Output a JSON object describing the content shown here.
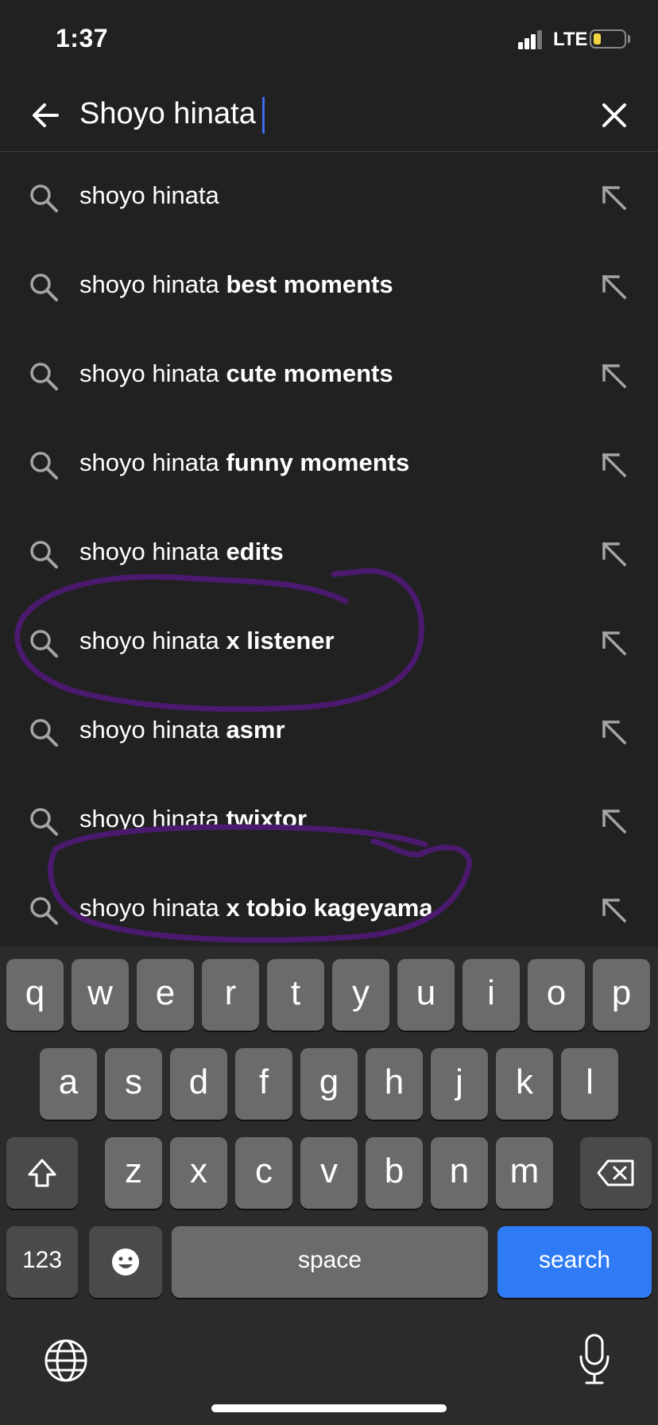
{
  "status": {
    "time": "1:37",
    "network": "LTE",
    "battery_level": 0.25,
    "signal_bars": 3
  },
  "search": {
    "query": "Shoyo hinata"
  },
  "suggestions": [
    {
      "prefix": "shoyo hinata",
      "suffix": ""
    },
    {
      "prefix": "shoyo hinata",
      "suffix": "best moments"
    },
    {
      "prefix": "shoyo hinata",
      "suffix": "cute moments"
    },
    {
      "prefix": "shoyo hinata",
      "suffix": "funny moments"
    },
    {
      "prefix": "shoyo hinata",
      "suffix": "edits"
    },
    {
      "prefix": "shoyo hinata",
      "suffix": "x listener"
    },
    {
      "prefix": "shoyo hinata",
      "suffix": "asmr"
    },
    {
      "prefix": "shoyo hinata",
      "suffix": "twixtor"
    },
    {
      "prefix": "shoyo hinata",
      "suffix": "x tobio kageyama"
    }
  ],
  "keyboard": {
    "row1": [
      "q",
      "w",
      "e",
      "r",
      "t",
      "y",
      "u",
      "i",
      "o",
      "p"
    ],
    "row2": [
      "a",
      "s",
      "d",
      "f",
      "g",
      "h",
      "j",
      "k",
      "l"
    ],
    "row3": [
      "z",
      "x",
      "c",
      "v",
      "b",
      "n",
      "m"
    ],
    "numbers_label": "123",
    "space_label": "space",
    "search_label": "search"
  },
  "colors": {
    "accent": "#2f7bf6",
    "annotation": "#4b1a6e",
    "caret": "#3b6bf0"
  },
  "icons": [
    "back-arrow-icon",
    "close-icon",
    "search-icon",
    "fill-arrow-icon",
    "shift-icon",
    "delete-icon",
    "emoji-icon",
    "globe-icon",
    "microphone-icon"
  ]
}
